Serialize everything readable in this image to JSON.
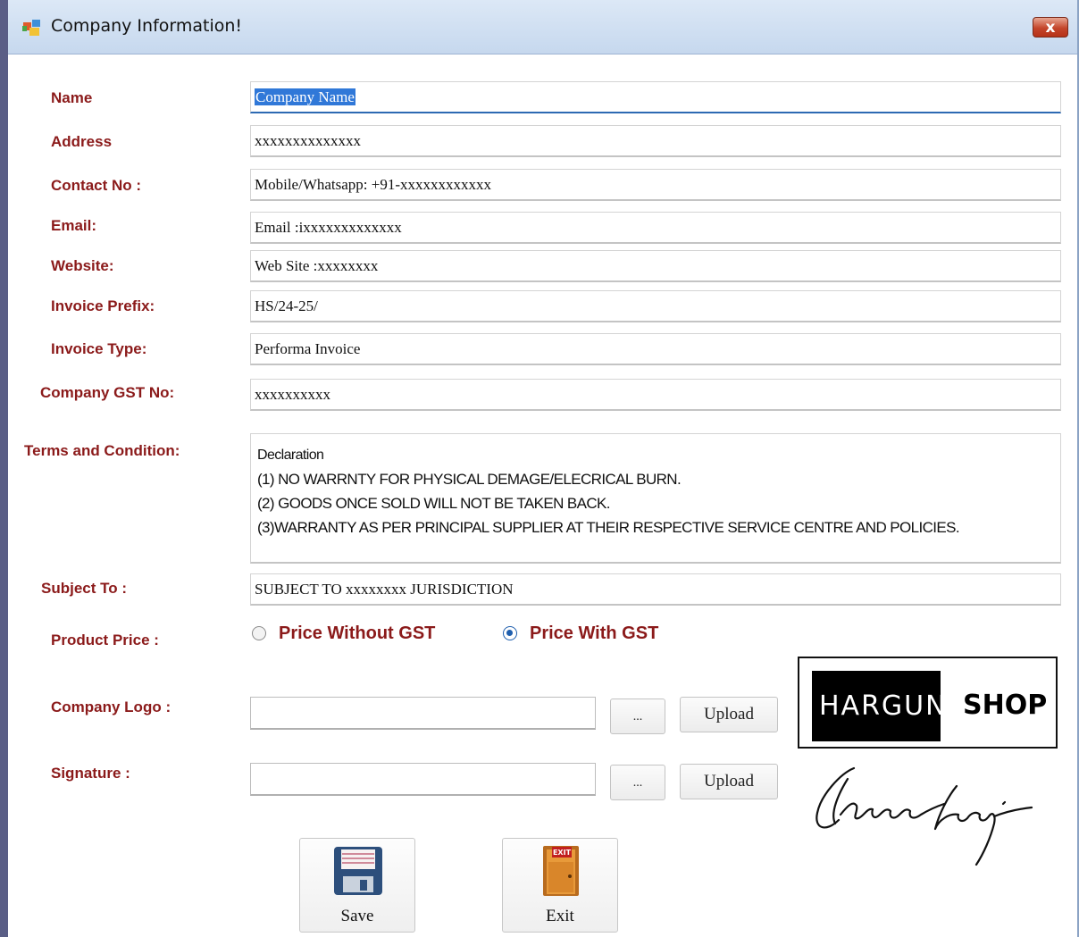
{
  "window": {
    "title": "Company Information!",
    "close_glyph": "x"
  },
  "labels": {
    "name": "Name",
    "address": "Address",
    "contact": "Contact No :",
    "email": "Email:",
    "website": "Website:",
    "invoice_prefix": "Invoice Prefix:",
    "invoice_type": "Invoice Type:",
    "gst": "Company GST No:",
    "terms": "Terms and Condition:",
    "subject": "Subject To :",
    "product_price": "Product Price :",
    "company_logo": "Company Logo :",
    "signature": "Signature :"
  },
  "fields": {
    "name": "Company Name",
    "address": "xxxxxxxxxxxxxx",
    "contact": "Mobile/Whatsapp: +91-xxxxxxxxxxxx",
    "email": "Email :ixxxxxxxxxxxxx",
    "website": "Web Site :xxxxxxxx",
    "invoice_prefix": "HS/24-25/",
    "invoice_type": "Performa Invoice",
    "gst": "xxxxxxxxxx",
    "subject": "SUBJECT TO xxxxxxxx JURISDICTION",
    "company_logo_path": "",
    "signature_path": ""
  },
  "terms_lines": [
    "Declaration",
    "(1) NO WARRNTY FOR PHYSICAL DEMAGE/ELECRICAL BURN.",
    "(2) GOODS ONCE SOLD WILL NOT BE TAKEN BACK.",
    "(3)WARRANTY AS PER PRINCIPAL SUPPLIER AT THEIR RESPECTIVE SERVICE CENTRE AND POLICIES."
  ],
  "product_price": {
    "options": [
      {
        "label": "Price Without GST",
        "selected": false
      },
      {
        "label": "Price With GST",
        "selected": true
      }
    ]
  },
  "buttons": {
    "browse": "...",
    "upload": "Upload",
    "save": "Save",
    "exit": "Exit"
  },
  "logo_preview": {
    "word1": "HARGUN",
    "word2": "SHOP"
  },
  "icons": {
    "app": "form-icon",
    "save": "floppy-disk-icon",
    "exit": "exit-door-icon",
    "exit_sign": "EXIT"
  },
  "colors": {
    "label": "#8b1a1a",
    "selection": "#3078d8",
    "radio_selected": "#1f5fae"
  }
}
